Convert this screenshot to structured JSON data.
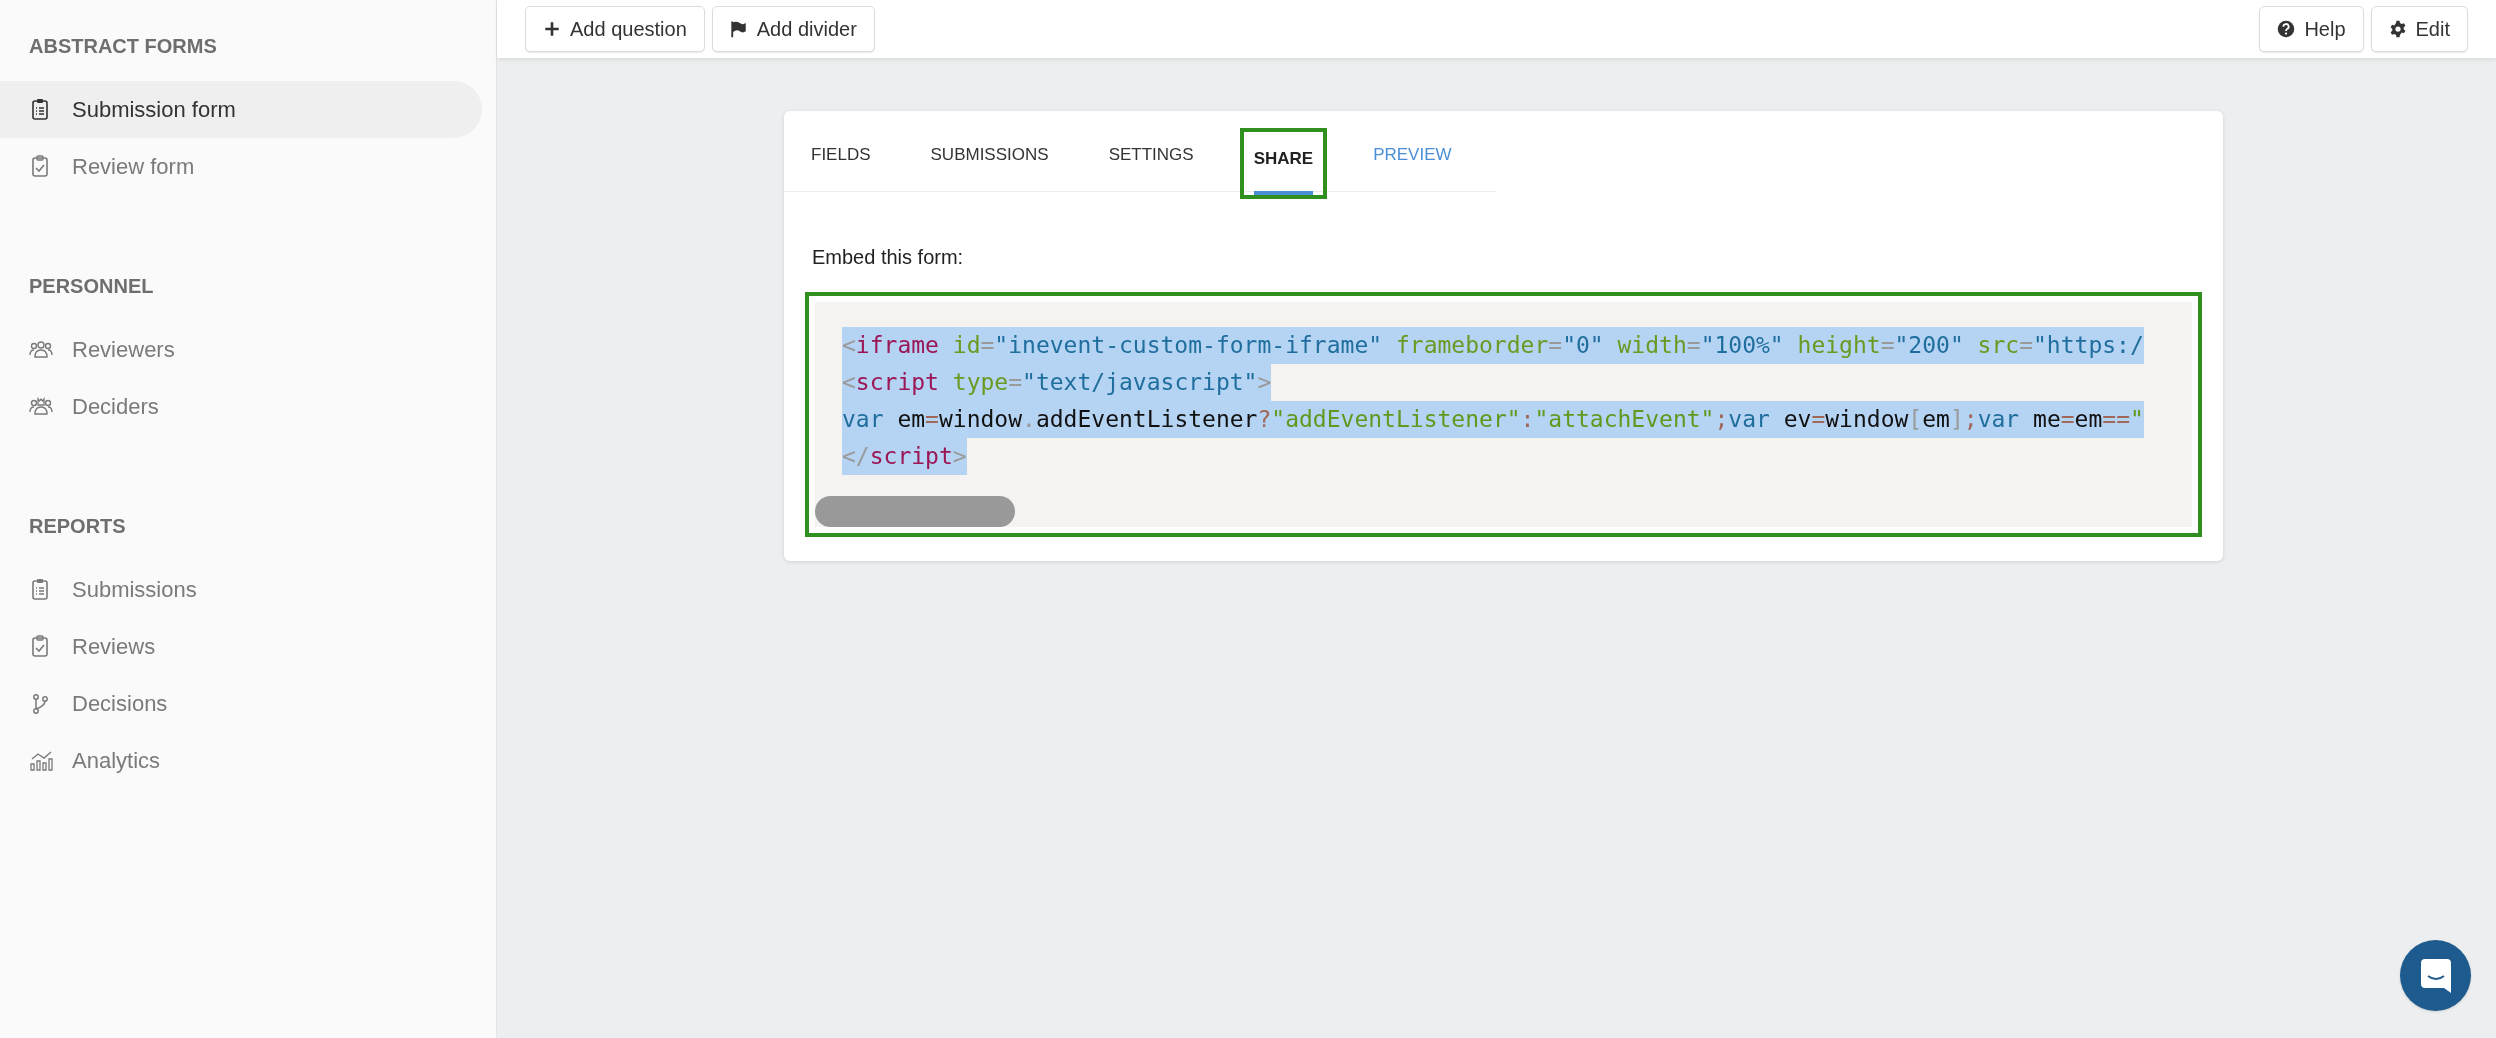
{
  "sidebar": {
    "sections": [
      {
        "title": "ABSTRACT FORMS",
        "items": [
          {
            "label": "Submission form",
            "selected": true
          },
          {
            "label": "Review form",
            "selected": false
          }
        ]
      },
      {
        "title": "PERSONNEL",
        "items": [
          {
            "label": "Reviewers",
            "selected": false
          },
          {
            "label": "Deciders",
            "selected": false
          }
        ]
      },
      {
        "title": "REPORTS",
        "items": [
          {
            "label": "Submissions",
            "selected": false
          },
          {
            "label": "Reviews",
            "selected": false
          },
          {
            "label": "Decisions",
            "selected": false
          },
          {
            "label": "Analytics",
            "selected": false
          }
        ]
      }
    ]
  },
  "toolbar": {
    "left": [
      {
        "label": "Add question"
      },
      {
        "label": "Add divider"
      }
    ],
    "right": [
      {
        "label": "Help"
      },
      {
        "label": "Edit"
      }
    ]
  },
  "tabs": [
    {
      "label": "FIELDS",
      "selected": false,
      "kind": "tab",
      "highlighted": false
    },
    {
      "label": "SUBMISSIONS",
      "selected": false,
      "kind": "tab",
      "highlighted": false
    },
    {
      "label": "SETTINGS",
      "selected": false,
      "kind": "tab",
      "highlighted": false
    },
    {
      "label": "SHARE",
      "selected": true,
      "kind": "tab",
      "highlighted": true
    },
    {
      "label": "PREVIEW",
      "selected": false,
      "kind": "link",
      "highlighted": false
    }
  ],
  "embed": {
    "label": "Embed this form:",
    "highlighted": true,
    "lines": [
      {
        "selected": true,
        "tokens": [
          {
            "text": "<",
            "kind": "punct"
          },
          {
            "text": "iframe",
            "kind": "tag"
          },
          {
            "text": " id",
            "kind": "attr"
          },
          {
            "text": "=",
            "kind": "punct"
          },
          {
            "text": "\"inevent-custom-form-iframe\"",
            "kind": "string"
          },
          {
            "text": " frameborder",
            "kind": "attr"
          },
          {
            "text": "=",
            "kind": "punct"
          },
          {
            "text": "\"0\"",
            "kind": "string"
          },
          {
            "text": " width",
            "kind": "attr"
          },
          {
            "text": "=",
            "kind": "punct"
          },
          {
            "text": "\"100%\"",
            "kind": "string"
          },
          {
            "text": " height",
            "kind": "attr"
          },
          {
            "text": "=",
            "kind": "punct"
          },
          {
            "text": "\"200\"",
            "kind": "string"
          },
          {
            "text": " src",
            "kind": "attr"
          },
          {
            "text": "=",
            "kind": "punct"
          },
          {
            "text": "\"https:/",
            "kind": "string"
          }
        ]
      },
      {
        "selected": true,
        "tokens": [
          {
            "text": "<",
            "kind": "punct"
          },
          {
            "text": "script",
            "kind": "tag"
          },
          {
            "text": " type",
            "kind": "attr"
          },
          {
            "text": "=",
            "kind": "punct"
          },
          {
            "text": "\"text/javascript\"",
            "kind": "string"
          },
          {
            "text": ">",
            "kind": "punct"
          }
        ]
      },
      {
        "selected": true,
        "tokens": [
          {
            "text": "var",
            "kind": "keyword"
          },
          {
            "text": " em",
            "kind": "plain"
          },
          {
            "text": "=",
            "kind": "op"
          },
          {
            "text": "window",
            "kind": "plain"
          },
          {
            "text": ".",
            "kind": "punct"
          },
          {
            "text": "addEventListener",
            "kind": "plain"
          },
          {
            "text": "?",
            "kind": "op"
          },
          {
            "text": "\"addEventListener\"",
            "kind": "str2"
          },
          {
            "text": ":",
            "kind": "op"
          },
          {
            "text": "\"attachEvent\"",
            "kind": "str2"
          },
          {
            "text": ";",
            "kind": "op"
          },
          {
            "text": "var",
            "kind": "keyword"
          },
          {
            "text": " ev",
            "kind": "plain"
          },
          {
            "text": "=",
            "kind": "op"
          },
          {
            "text": "window",
            "kind": "plain"
          },
          {
            "text": "[",
            "kind": "punct"
          },
          {
            "text": "em",
            "kind": "plain"
          },
          {
            "text": "]",
            "kind": "punct"
          },
          {
            "text": ";",
            "kind": "op"
          },
          {
            "text": "var",
            "kind": "keyword"
          },
          {
            "text": " me",
            "kind": "plain"
          },
          {
            "text": "=",
            "kind": "op"
          },
          {
            "text": "em",
            "kind": "plain"
          },
          {
            "text": "==",
            "kind": "op"
          },
          {
            "text": "\"",
            "kind": "str2"
          }
        ]
      },
      {
        "selected": true,
        "tokens": [
          {
            "text": "</",
            "kind": "punct"
          },
          {
            "text": "script",
            "kind": "tag"
          },
          {
            "text": ">",
            "kind": "punct"
          }
        ]
      }
    ]
  }
}
